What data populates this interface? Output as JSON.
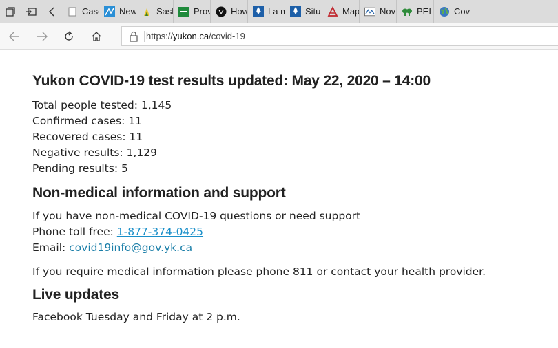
{
  "tabs": [
    {
      "label": "Case",
      "icon": "document-icon"
    },
    {
      "label": "New",
      "icon": "chart-icon"
    },
    {
      "label": "Sask",
      "icon": "sask-icon"
    },
    {
      "label": "Prov",
      "icon": "prov-icon"
    },
    {
      "label": "How",
      "icon": "ontario-icon"
    },
    {
      "label": "La m",
      "icon": "quebec-icon"
    },
    {
      "label": "Situ",
      "icon": "quebec-icon"
    },
    {
      "label": "Map",
      "icon": "map-icon"
    },
    {
      "label": "Nov",
      "icon": "ns-icon"
    },
    {
      "label": "PEI (",
      "icon": "pei-icon"
    },
    {
      "label": "Cov",
      "icon": "globe-icon"
    }
  ],
  "address": {
    "scheme": "https://",
    "host": "yukon.ca",
    "path": "/covid-19"
  },
  "colors": {
    "link": "#1a8fc9",
    "email": "#1a7ea8",
    "text": "#222222"
  },
  "page": {
    "heading": "Yukon COVID-19 test results updated: May 22, 2020 – 14:00",
    "stats": [
      "Total people tested: 1,145",
      "Confirmed cases: 11",
      "Recovered cases: 11",
      "Negative results: 1,129",
      "Pending results: 5"
    ],
    "support_heading": "Non-medical information and support",
    "support_line": "If you have non-medical COVID-19 questions or need support",
    "phone_label": "Phone toll free: ",
    "phone_number": "1-877-374-0425",
    "email_label": "Email: ",
    "email": "covid19info@gov.yk.ca",
    "medical_line": "If you require medical information please phone 811 or contact your health provider.",
    "updates_heading": "Live updates",
    "updates_line": "Facebook Tuesday and Friday at 2 p.m."
  }
}
